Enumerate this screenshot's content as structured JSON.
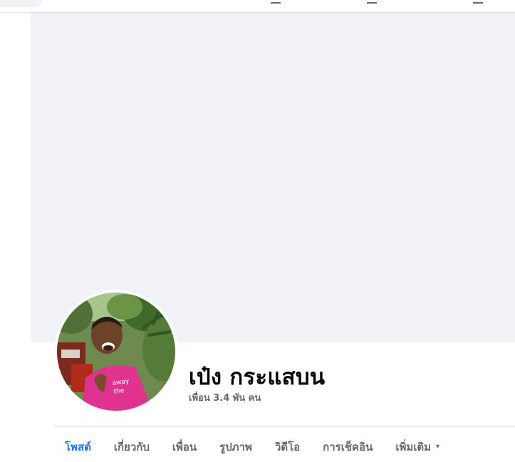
{
  "profile": {
    "name": "เป๋ง กระแสบน",
    "friends_text": "เพื่อน 3.4 พัน คน"
  },
  "tabs": [
    {
      "label": "โพสต์",
      "active": true
    },
    {
      "label": "เกี่ยวกับ",
      "active": false
    },
    {
      "label": "เพื่อน",
      "active": false
    },
    {
      "label": "รูปภาพ",
      "active": false
    },
    {
      "label": "วิดีโอ",
      "active": false
    },
    {
      "label": "การเช็คอิน",
      "active": false
    },
    {
      "label": "เพิ่มเติม",
      "active": false
    }
  ],
  "more_caret": "▾",
  "colors": {
    "accent": "#1877f2",
    "cover_bg": "#f0f2f5",
    "secondary_text": "#65676b"
  }
}
